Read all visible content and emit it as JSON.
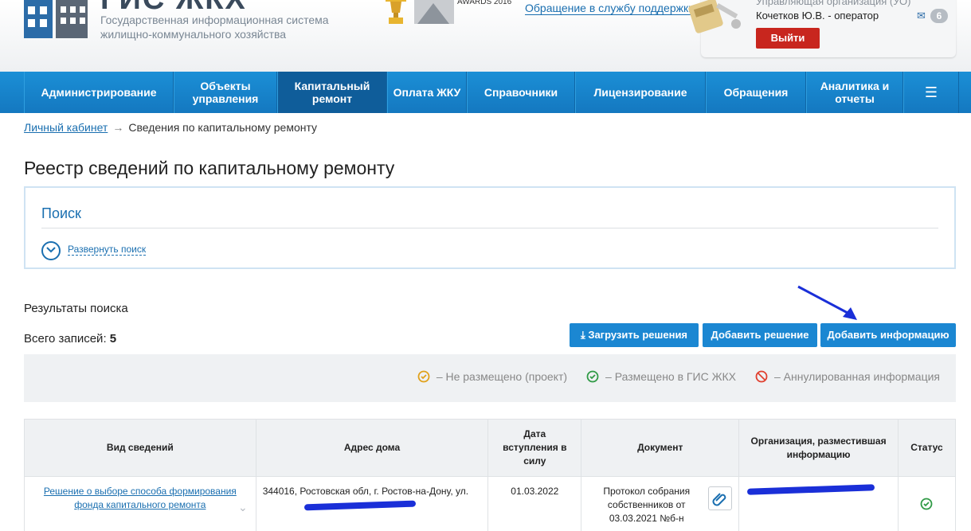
{
  "header": {
    "brand_title": "ГИС ЖКХ",
    "brand_subtitle_line1": "Государственная информационная система",
    "brand_subtitle_line2": "жилищно-коммунального хозяйства",
    "award_text": "AWARDS 2016",
    "support_link": "Обращение в службу поддержки",
    "org_text": "Управляющая организация (УО)",
    "user_name": "Кочетков Ю.В. - оператор",
    "logout_label": "Выйти",
    "messages_count": "6"
  },
  "nav": {
    "items": [
      {
        "label": "Администрирование"
      },
      {
        "label": "Объекты управления"
      },
      {
        "label": "Капитальный ремонт"
      },
      {
        "label": "Оплата ЖКУ"
      },
      {
        "label": "Справочники"
      },
      {
        "label": "Лицензирование"
      },
      {
        "label": "Обращения"
      },
      {
        "label": "Аналитика и отчеты"
      }
    ],
    "menu_icon": "hamburger-icon"
  },
  "breadcrumb": {
    "home": "Личный кабинет",
    "separator": "→",
    "current": "Сведения по капитальному ремонту"
  },
  "page_title": "Реестр сведений по капитальному ремонту",
  "search": {
    "title": "Поиск",
    "expand_label": "Развернуть поиск"
  },
  "results": {
    "label": "Результаты поиска",
    "total_label": "Всего записей:",
    "total_value": "5"
  },
  "actions": {
    "upload": "Загрузить решения",
    "add_decision": "Добавить решение",
    "add_info": "Добавить информацию"
  },
  "legend": {
    "draft": "–  Не размещено (проект)",
    "published": "–  Размещено в ГИС ЖКХ",
    "cancelled": "–  Аннулированная информация"
  },
  "colors": {
    "nav": "#1b87d2",
    "accent": "#1a6fb0",
    "logout": "#c8261e",
    "draft": "#e0a11b",
    "published": "#2f9a45",
    "cancelled": "#e0402f"
  },
  "table": {
    "headers": [
      "Вид сведений",
      "Адрес дома",
      "Дата вступления в силу",
      "Документ",
      "Организация, разместившая информацию",
      "Статус"
    ],
    "rows": [
      {
        "type": "Решение о выборе способа формирования фонда капитального ремонта",
        "address": "344016, Ростовская обл, г. Ростов-на-Дону, ул.",
        "date": "01.03.2022",
        "document": "Протокол собрания собственников от 03.03.2021 №б-н",
        "status": "published"
      }
    ]
  }
}
